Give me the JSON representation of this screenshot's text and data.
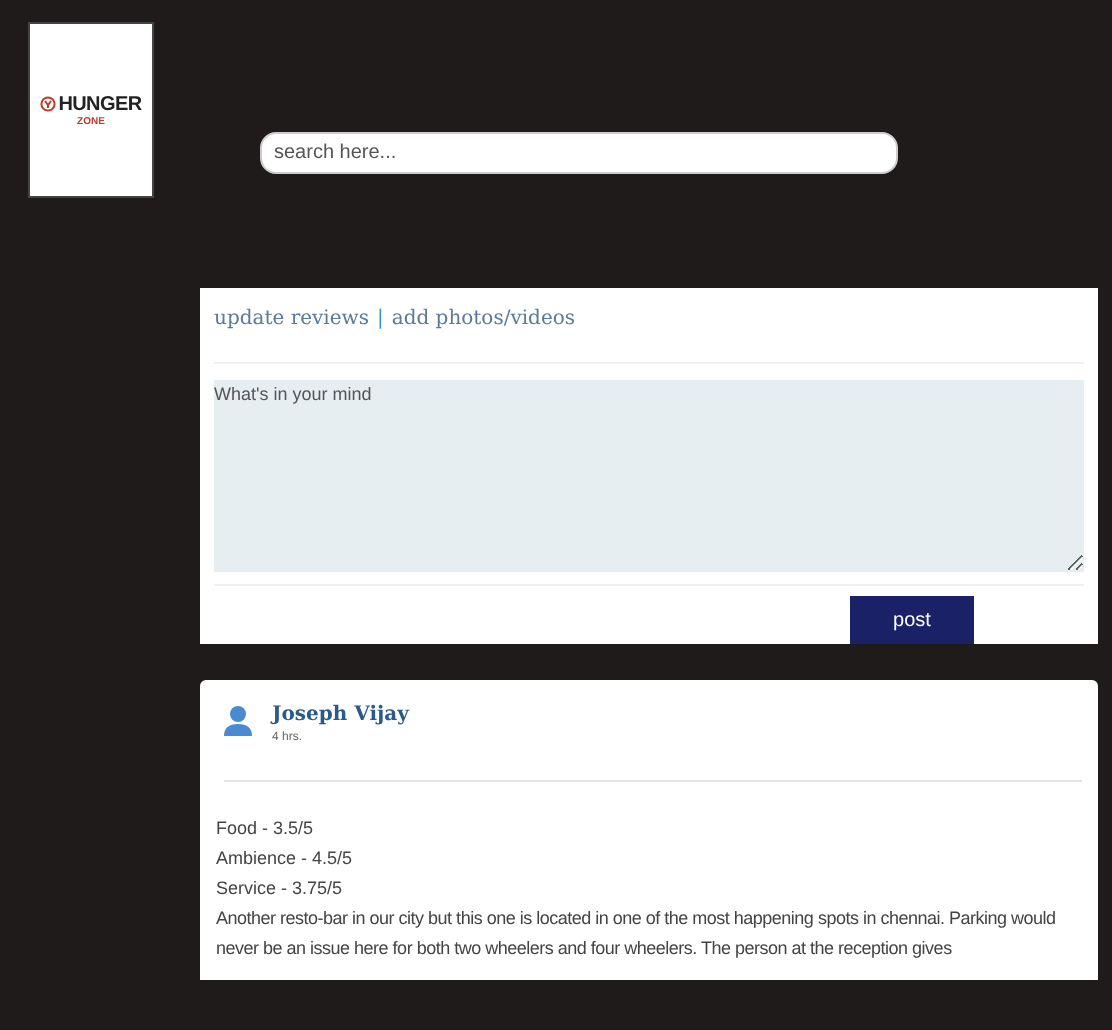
{
  "logo": {
    "name": "HUNGER",
    "tagline": "ZONE"
  },
  "search": {
    "placeholder": "search here..."
  },
  "composer": {
    "links": [
      "update reviews",
      "add photos/videos"
    ],
    "separator": "|",
    "placeholder": "What's in your mind",
    "button": "post"
  },
  "post": {
    "author": "Joseph Vijay",
    "time": "4 hrs.",
    "ratings": [
      "Food - 3.5/5",
      "Ambience - 4.5/5",
      "Service - 3.75/5"
    ],
    "text": "Another resto-bar in our city but this one is located in one of the most happening spots in chennai. Parking would never be an issue here for both two wheelers and four wheelers. The person at the reception gives"
  }
}
